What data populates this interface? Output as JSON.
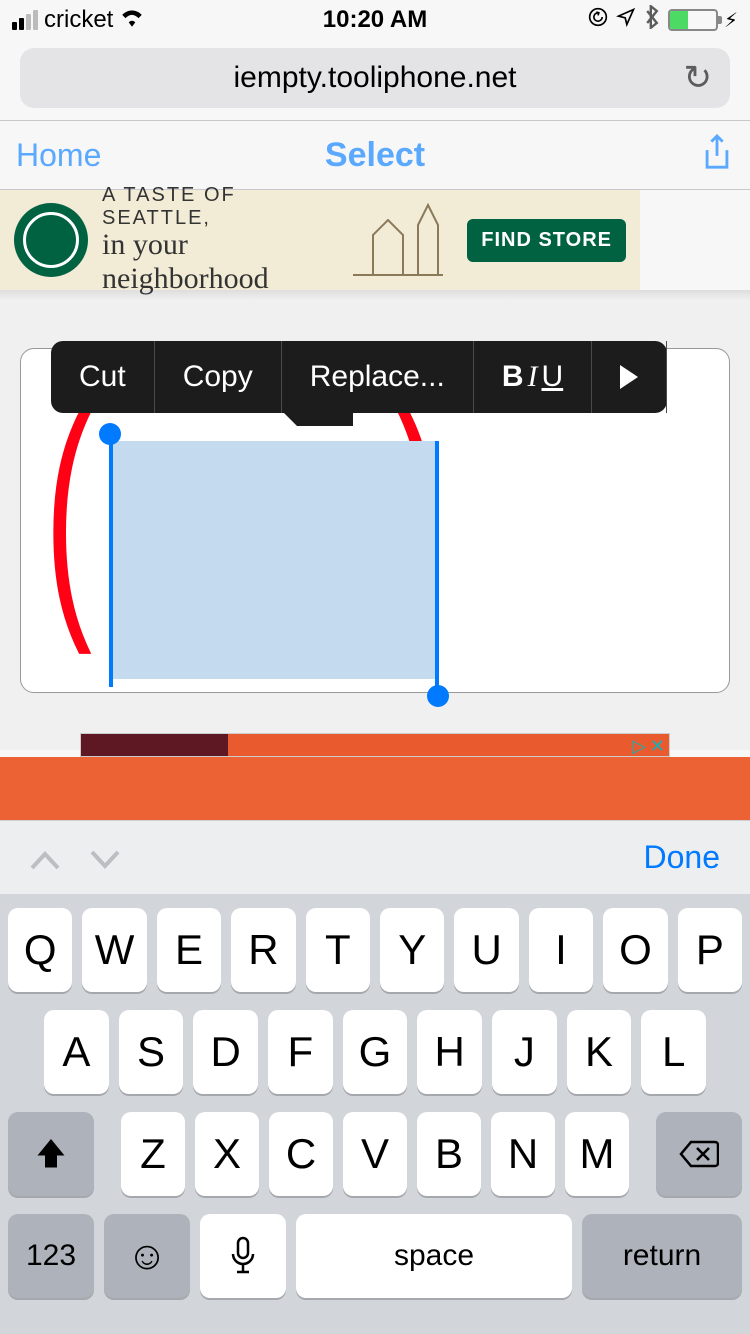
{
  "status": {
    "carrier": "cricket",
    "time": "10:20 AM"
  },
  "browser": {
    "url": "iempty.tooliphone.net"
  },
  "nav": {
    "back": "Home",
    "title": "Select"
  },
  "ad": {
    "line1": "A TASTE OF SEATTLE,",
    "line2": "in your neighborhood",
    "cta": "FIND STORE"
  },
  "context_menu": {
    "cut": "Cut",
    "copy": "Copy",
    "replace": "Replace...",
    "b": "B",
    "i": "I",
    "u": "U"
  },
  "accessory": {
    "done": "Done"
  },
  "keyboard": {
    "r1": [
      "Q",
      "W",
      "E",
      "R",
      "T",
      "Y",
      "U",
      "I",
      "O",
      "P"
    ],
    "r2": [
      "A",
      "S",
      "D",
      "F",
      "G",
      "H",
      "J",
      "K",
      "L"
    ],
    "r3": [
      "Z",
      "X",
      "C",
      "V",
      "B",
      "N",
      "M"
    ],
    "num": "123",
    "space": "space",
    "return": "return"
  }
}
